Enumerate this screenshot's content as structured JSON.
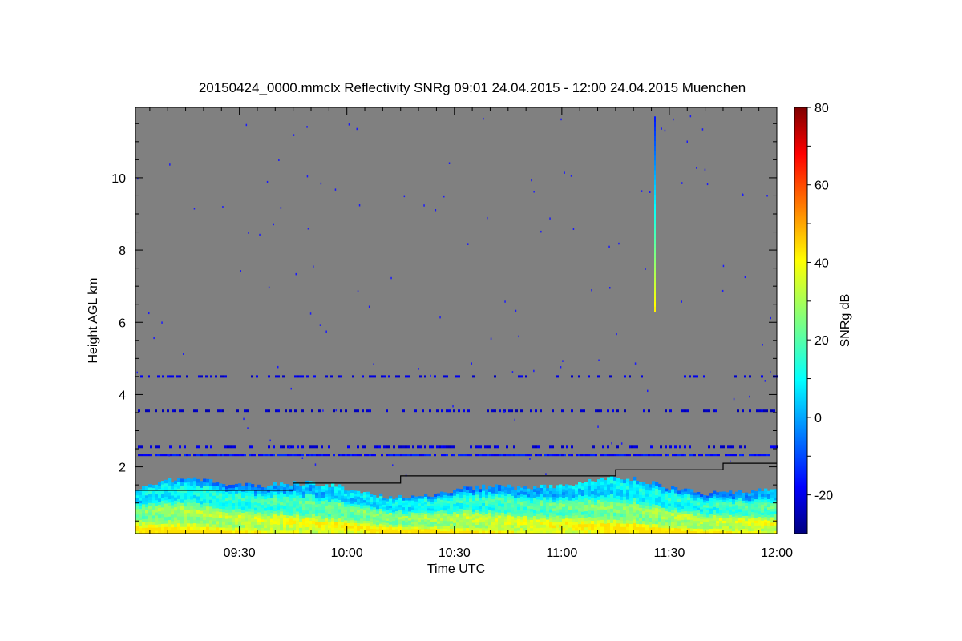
{
  "chart_data": {
    "type": "heatmap",
    "title": "20150424_0000.mmclx Reflectivity SNRg   09:01 24.04.2015 - 12:00 24.04.2015 Muenchen",
    "xlabel": "Time UTC",
    "ylabel": "Height AGL km",
    "colorbar_label": "SNRg dB",
    "x_range_utc": [
      "09:01",
      "12:00"
    ],
    "x_ticks": [
      "09:30",
      "10:00",
      "10:30",
      "11:00",
      "11:30",
      "12:00"
    ],
    "y_range_km": [
      0.15,
      11.95
    ],
    "y_ticks": [
      2,
      4,
      6,
      8,
      10
    ],
    "colorbar_range_db": [
      -30,
      80
    ],
    "colorbar_ticks": [
      -20,
      0,
      20,
      40,
      60,
      80
    ],
    "colormap": "jet",
    "background_color": "#808080",
    "line_color": "#000000",
    "black_line_height_km": [
      {
        "x": "09:01",
        "y": 1.35
      },
      {
        "x": "09:45",
        "y": 1.35
      },
      {
        "x": "09:45",
        "y": 1.55
      },
      {
        "x": "10:15",
        "y": 1.55
      },
      {
        "x": "10:15",
        "y": 1.75
      },
      {
        "x": "11:15",
        "y": 1.75
      },
      {
        "x": "11:15",
        "y": 1.92
      },
      {
        "x": "11:45",
        "y": 1.92
      },
      {
        "x": "11:45",
        "y": 2.1
      },
      {
        "x": "12:00",
        "y": 2.1
      }
    ],
    "features": [
      {
        "name": "boundary layer echo",
        "height_km": [
          0.15,
          1.6
        ],
        "snr_db": [
          -10,
          40
        ]
      },
      {
        "name": "noise band",
        "height_km": 2.33,
        "snr_db": -15
      },
      {
        "name": "noise band",
        "height_km": 2.55,
        "snr_db": -20
      },
      {
        "name": "noise band",
        "height_km": 3.55,
        "snr_db": -22
      },
      {
        "name": "noise band",
        "height_km": 4.5,
        "snr_db": -20
      },
      {
        "name": "vertical streak",
        "time": "11:26",
        "height_km": [
          6.3,
          11.7
        ],
        "snr_db": [
          -15,
          40
        ]
      }
    ]
  }
}
